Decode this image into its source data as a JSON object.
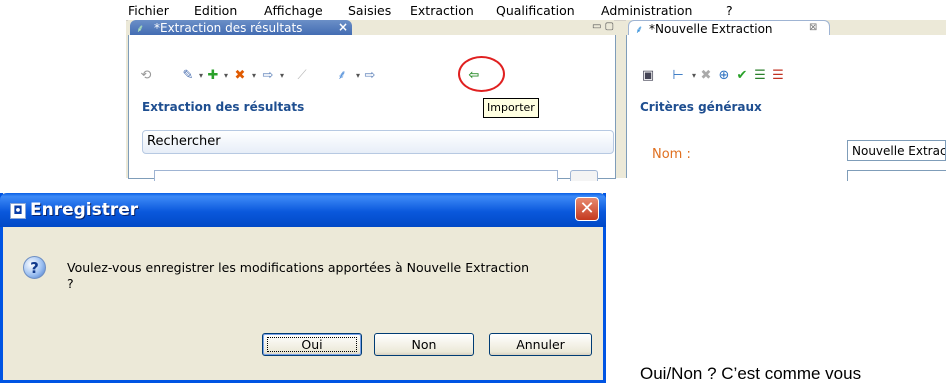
{
  "menu": [
    "Fichier",
    "Edition",
    "Affichage",
    "Saisies",
    "Extraction",
    "Qualification",
    "Administration",
    "?"
  ],
  "left_view": {
    "tab_label": "*Extraction des résultats",
    "tab_close": "×",
    "minmax": "▭ ▢",
    "section_title": "Extraction des résultats",
    "search_label": "Rechercher",
    "tooltip": "Importer"
  },
  "right_view": {
    "tab_label": "*Nouvelle Extraction",
    "tab_close": "⊠",
    "section_title": "Critères généraux",
    "nom_label": "Nom :",
    "nom_value": "Nouvelle Extraction"
  },
  "dialog": {
    "title": "Enregistrer",
    "title_icon": "◘",
    "close": "✕",
    "question_icon": "?",
    "message": "Voulez-vous enregistrer les modifications apportées à Nouvelle Extraction",
    "message_line2": "?",
    "buttons": {
      "yes": "Oui",
      "no": "Non",
      "cancel": "Annuler"
    }
  },
  "caption": "Oui/Non ? C’est comme vous",
  "colors": {
    "accent": "#0054e3",
    "eclipse_blue": "#1e4e90",
    "highlight": "#e02020",
    "orange_label": "#e07020"
  }
}
